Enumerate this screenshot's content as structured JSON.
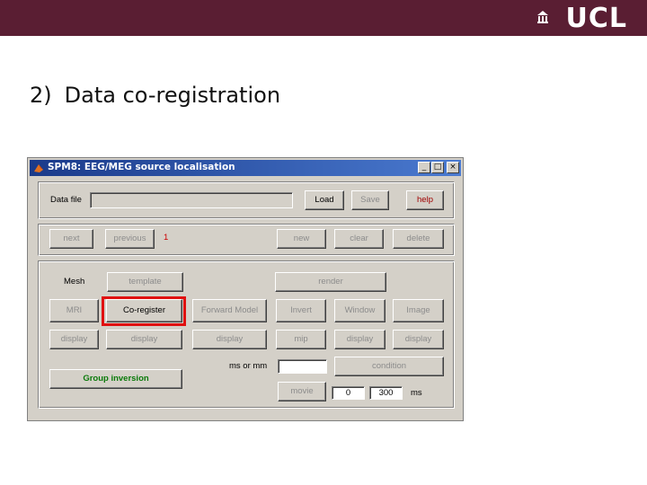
{
  "header": {
    "logo_text": "UCL",
    "bar_color": "#5a1e33"
  },
  "slide": {
    "number": "2)",
    "title": "Data co-registration"
  },
  "window": {
    "title": "SPM8: EEG/MEG source localisation",
    "controls": {
      "minimize": "_",
      "maximize": "□",
      "close": "×"
    }
  },
  "file_row": {
    "label": "Data file",
    "value": "",
    "load": "Load",
    "save": "Save",
    "help": "help"
  },
  "nav_row": {
    "next": "next",
    "previous": "previous",
    "index": "1",
    "new": "new",
    "clear": "clear",
    "delete": "delete"
  },
  "main": {
    "mesh_label": "Mesh",
    "template": "template",
    "render": "render",
    "mri": "MRI",
    "coregister": "Co-register",
    "forward_model": "Forward Model",
    "invert": "Invert",
    "window": "Window",
    "image": "Image",
    "display_buttons": [
      "display",
      "display",
      "display",
      "mip",
      "display",
      "display"
    ],
    "ms_or_mm_label": "ms or mm",
    "ms_or_mm_value": "",
    "condition": "condition",
    "group_inversion": "Group inversion",
    "movie": "movie",
    "movie_start": "0",
    "movie_end": "300",
    "ms_label": "ms"
  },
  "highlight_color": "#e01010"
}
